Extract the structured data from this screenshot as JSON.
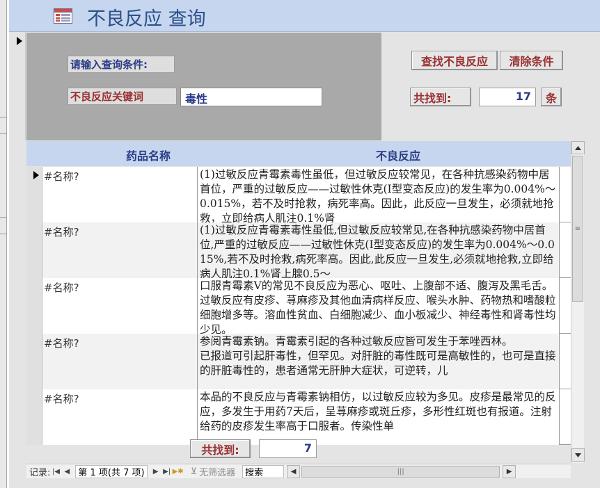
{
  "window": {
    "title": "不良反应 查询"
  },
  "criteria": {
    "prompt_label": "请输入查询条件:",
    "keyword_label": "不良反应关键词",
    "keyword_value": "毒性"
  },
  "buttons": {
    "find": "查找不良反应",
    "clear": "清除条件"
  },
  "result_summary": {
    "found_label": "共找到:",
    "count": "17",
    "unit": "条"
  },
  "grid": {
    "columns": [
      "药品名称",
      "不良反应"
    ],
    "rows": [
      {
        "name": "#名称?",
        "reaction": "(1)过敏反应青霉素毒性虽低，但过敏反应较常见，在各种抗感染药物中居首位，严重的过敏反应——过敏性休克(Ⅰ型变态反应)的发生率为0.004%～0.015%，若不及时抢救，病死率高。因此，此反应一旦发生，必须就地抢救，立即给病人肌注0.1%肾"
      },
      {
        "name": "#名称?",
        "reaction": "(1)过敏反应青霉素毒性虽低,但过敏反应较常见,在各种抗感染药物中居首位,严重的过敏反应——过敏性休克(Ⅰ型变态反应)的发生率为0.004%～0.015%,若不及时抢救,病死率高。因此,此反应一旦发生,必须就地抢救,立即给病人肌注0.1%肾上腺0.5～"
      },
      {
        "name": "#名称?",
        "reaction": "口服青霉素V的常见不良反应为恶心、呕吐、上腹部不适、腹泻及黑毛舌。过敏反应有皮疹、荨麻疹及其他血清病样反应、喉头水肿、药物热和嗜酸粒细胞增多等。溶血性贫血、白细胞减少、血小板减少、神经毒性和肾毒性均少见。"
      },
      {
        "name": "#名称?",
        "reaction": "参阅青霉素钠。青霉素引起的各种过敏反应皆可发生于苯唑西林。\n已报道可引起肝毒性，但罕见。对肝脏的毒性既可是高敏性的，也可是直接的肝脏毒性的，患者通常无肝肿大症状，可逆转，儿"
      },
      {
        "name": "#名称?",
        "reaction": "本品的不良反应与青霉素钠相仿，以过敏反应较为多见。皮疹是最常见的反应，多发生于用药7天后，呈荨麻疹或斑丘疹，多形性红斑也有报道。注射给药的皮疹发生率高于口服者。传染性单"
      }
    ]
  },
  "footer": {
    "found_label": "共找到:",
    "count": "7"
  },
  "nav_bar": {
    "record_label": "记录:",
    "record_position": "第 1 项(共 7 项)",
    "filter_label": "无筛选器",
    "search_label": "搜索"
  },
  "colors": {
    "title_bar": "#c6d6ee",
    "title_text": "#2a4f8a",
    "label_red": "#9a3030",
    "label_blue": "#2b3c86",
    "panel_gray": "#a9a9a9"
  }
}
